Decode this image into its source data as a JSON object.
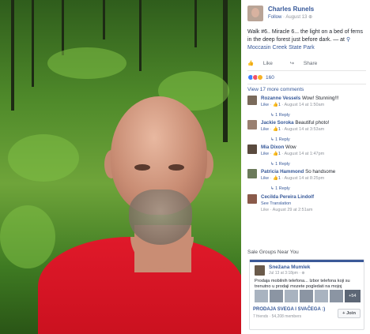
{
  "post": {
    "author": "Charles Runels",
    "follow": "Follow",
    "date": "August 13",
    "text": "Walk #6.. Miracle 6... the light on a bed of ferns in the deep forest just before dark.",
    "at": "— at",
    "location": "Moccasin Creek State Park",
    "like": "Like",
    "share": "Share",
    "reaction_count": "160",
    "more_comments": "View 17 more comments"
  },
  "comments": [
    {
      "name": "Rozanne Vessels",
      "text": "Wow! Stunning!!!",
      "like": "Like",
      "likes": "1",
      "time": "August 14 at 1:50am",
      "reply": "1 Reply"
    },
    {
      "name": "Jackie Soroka",
      "text": "Beautiful photo!",
      "like": "Like",
      "likes": "1",
      "time": "August 14 at 3:53am",
      "reply": "1 Reply"
    },
    {
      "name": "Mia Dixon",
      "text": "Wow",
      "like": "Like",
      "likes": "1",
      "time": "August 14 at 1:47pm",
      "reply": "1 Reply"
    },
    {
      "name": "Patricia Hammond",
      "text": "So handsome",
      "like": "Like",
      "likes": "1",
      "time": "August 14 at 8:25pm",
      "reply": "1 Reply"
    },
    {
      "name": "Cecilda Pereira Lindolf",
      "text": "",
      "like": "See Translation",
      "likes": "",
      "time": "Like · August 29 at 2:51am",
      "reply": ""
    }
  ],
  "sale": {
    "heading": "Sale Groups Near You",
    "name": "Snežana Mumlek",
    "time": "Jul 13 at 3:18pm · ",
    "text": "Prodaja mobilnih telefona... Izbor telefona koji su trenutno u prodaji mozete pogledati na mojoj",
    "more_photos": "+54",
    "group": "PRODAJA SVEGA I SVAČEGA :)",
    "members": "7 friends · 54,208 members",
    "join": "+ Join"
  },
  "colors": {
    "link": "#365899",
    "shirt": "#e0192a"
  }
}
